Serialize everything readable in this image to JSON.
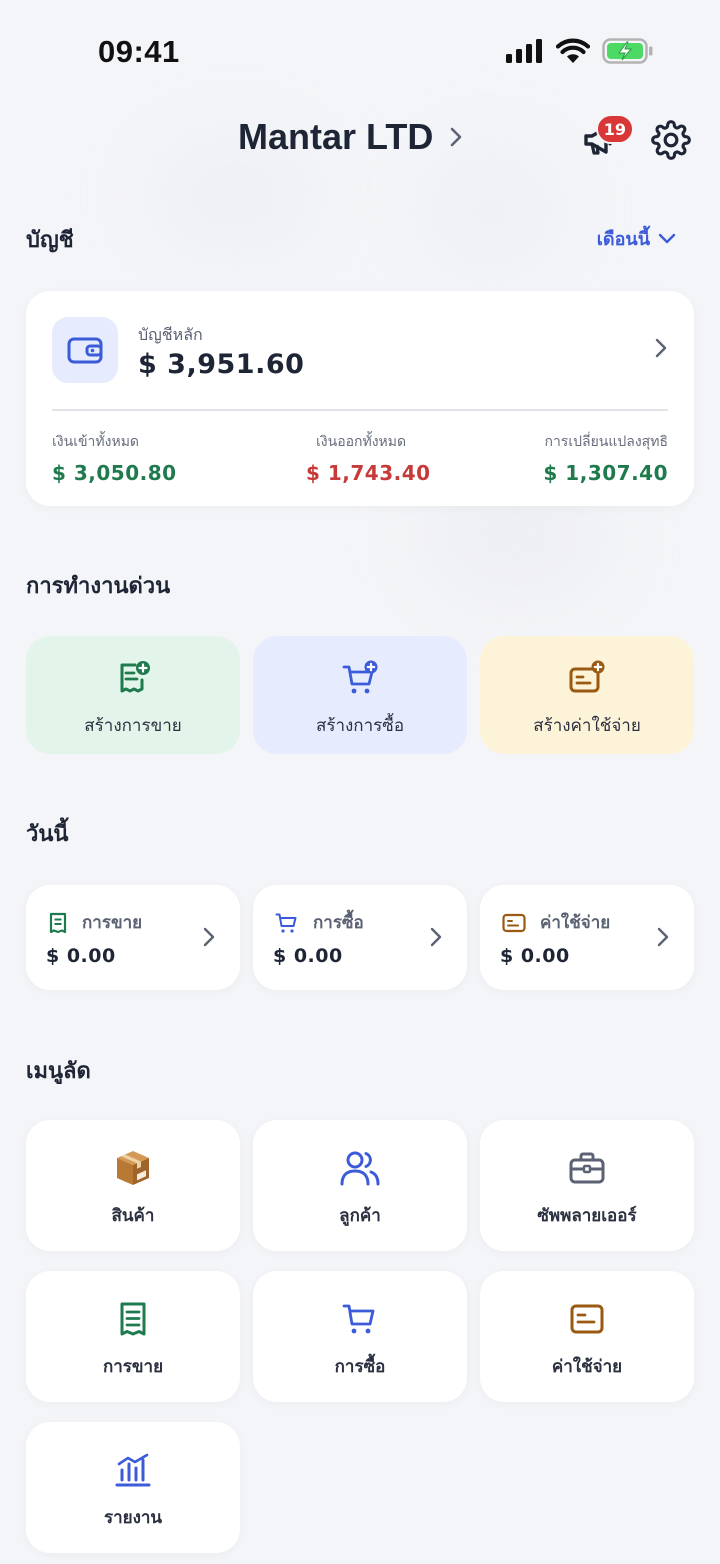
{
  "status_bar": {
    "time": "09:41"
  },
  "header": {
    "company_name": "Mantar LTD",
    "notification_count": "19"
  },
  "accounts": {
    "section_title": "บัญชี",
    "period": "เดือนนี้",
    "main_label": "บัญชีหลัก",
    "main_balance": "$ 3,951.60",
    "income_label": "เงินเข้าทั้งหมด",
    "income_value": "$ 3,050.80",
    "expense_label": "เงินออกทั้งหมด",
    "expense_value": "$ 1,743.40",
    "net_label": "การเปลี่ยนแปลงสุทธิ",
    "net_value": "$ 1,307.40"
  },
  "quick_actions": {
    "section_title": "การทำงานด่วน",
    "items": [
      {
        "label": "สร้างการขาย",
        "icon": "receipt-plus-icon"
      },
      {
        "label": "สร้างการซื้อ",
        "icon": "cart-plus-icon"
      },
      {
        "label": "สร้างค่าใช้จ่าย",
        "icon": "expense-plus-icon"
      }
    ]
  },
  "today": {
    "section_title": "วันนี้",
    "items": [
      {
        "label": "การขาย",
        "value": "$ 0.00",
        "icon": "receipt-icon"
      },
      {
        "label": "การซื้อ",
        "value": "$ 0.00",
        "icon": "cart-icon"
      },
      {
        "label": "ค่าใช้จ่าย",
        "value": "$ 0.00",
        "icon": "expense-icon"
      }
    ]
  },
  "shortcuts": {
    "section_title": "เมนูลัด",
    "items": [
      {
        "label": "สินค้า",
        "icon": "package-icon"
      },
      {
        "label": "ลูกค้า",
        "icon": "customers-icon"
      },
      {
        "label": "ซัพพลายเออร์",
        "icon": "briefcase-icon"
      },
      {
        "label": "การขาย",
        "icon": "receipt-icon"
      },
      {
        "label": "การซื้อ",
        "icon": "cart-icon"
      },
      {
        "label": "ค่าใช้จ่าย",
        "icon": "expense-icon"
      },
      {
        "label": "รายงาน",
        "icon": "chart-icon"
      }
    ]
  },
  "colors": {
    "background": "#f4f5f8",
    "accent_blue": "#3b5bd9",
    "positive_green": "#1f7a4d",
    "negative_red": "#c73a3a",
    "sale_tile": "#e3f5ea",
    "purchase_tile": "#e6ecfd",
    "expense_tile": "#fdf3d9"
  }
}
